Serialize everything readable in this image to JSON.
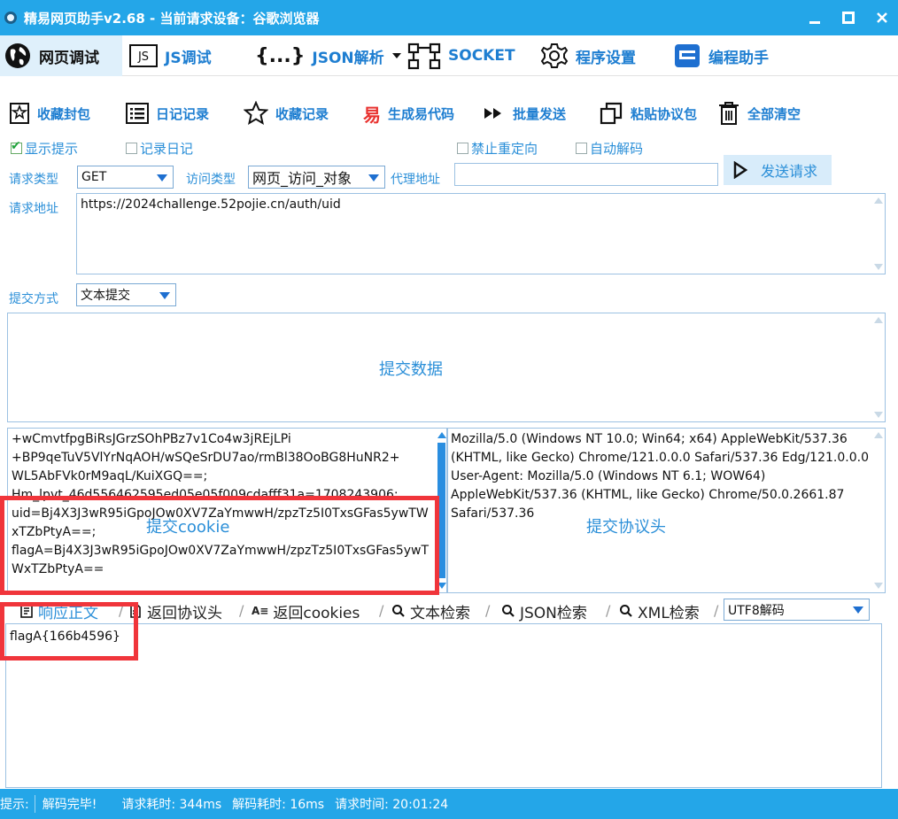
{
  "window": {
    "title": "精易网页助手v2.68  -  当前请求设备：谷歌浏览器"
  },
  "tabs": [
    {
      "label": "网页调试",
      "icon": "globe-icon"
    },
    {
      "label": "JS调试",
      "icon": "js-icon"
    },
    {
      "label": "JSON解析",
      "icon": "braces-icon"
    },
    {
      "label": "SOCKET",
      "icon": "socket-icon"
    },
    {
      "label": "程序设置",
      "icon": "gear-icon"
    },
    {
      "label": "编程助手",
      "icon": "assistant-icon"
    }
  ],
  "toolbar": [
    {
      "label": "收藏封包",
      "icon": "bookmark-icon"
    },
    {
      "label": "日记记录",
      "icon": "list-icon"
    },
    {
      "label": "收藏记录",
      "icon": "star-icon"
    },
    {
      "label": "生成易代码",
      "icon": "yi-icon",
      "icon_text": "易"
    },
    {
      "label": "批量发送",
      "icon": "fast-forward-icon"
    },
    {
      "label": "粘贴协议包",
      "icon": "copy-icon"
    },
    {
      "label": "全部清空",
      "icon": "trash-icon"
    }
  ],
  "options": {
    "show_tips": "显示提示",
    "log_diary": "记录日记",
    "no_redirect": "禁止重定向",
    "auto_decode": "自动解码"
  },
  "request": {
    "type_label": "请求类型",
    "type_value": "GET",
    "access_label": "访问类型",
    "access_value": "网页_访问_对象",
    "proxy_label": "代理地址",
    "proxy_value": "",
    "send_label": "发送请求",
    "url_label": "请求地址",
    "url_value": "https://2024challenge.52pojie.cn/auth/uid",
    "submit_mode_label": "提交方式",
    "submit_mode_value": "文本提交",
    "post_data_placeholder": "提交数据",
    "cookie_placeholder": "提交cookie",
    "cookie_value": "+wCmvtfpgBiRsJGrzSOhPBz7v1Co4w3jREjLPi\n+BP9qeTuV5VlYrNqAOH/wSQeSrDU7ao/rmBl38OoBG8HuNR2+\nWL5AbFVk0rM9aqL/KuiXGQ==;\nHm_lpvt_46d556462595ed05e05f009cdafff31a=1708243906;\nuid=Bj4X3J3wR95iGpoJOw0XV7ZaYmwwH/zpzTz5I0TxsGFas5ywTWxTZbPtyA==;\nflagA=Bj4X3J3wR95iGpoJOw0XV7ZaYmwwH/zpzTz5I0TxsGFas5ywTWxTZbPtyA==",
    "headers_placeholder": "提交协议头",
    "headers_value": "Mozilla/5.0 (Windows NT 10.0; Win64; x64) AppleWebKit/537.36 (KHTML, like Gecko) Chrome/121.0.0.0 Safari/537.36 Edg/121.0.0.0\nUser-Agent: Mozilla/5.0 (Windows NT 6.1; WOW64) AppleWebKit/537.36 (KHTML, like Gecko) Chrome/50.0.2661.87 Safari/537.36"
  },
  "response_tabs": [
    {
      "label": "响应正文",
      "icon": "document-icon"
    },
    {
      "label": "返回协议头",
      "icon": "file-icon"
    },
    {
      "label": "返回cookies",
      "icon": "cookie-icon"
    },
    {
      "label": "文本检索",
      "icon": "search-icon"
    },
    {
      "label": "JSON检索",
      "icon": "search-icon"
    },
    {
      "label": "XML检索",
      "icon": "search-icon"
    }
  ],
  "decode_value": "UTF8解码",
  "response_body": "flagA{166b4596}",
  "status": {
    "prefix": "提示:",
    "message": "解码完毕!",
    "request_time": "请求耗时: 344ms",
    "decode_time": "解码耗时: 16ms",
    "request_at": "请求时间: 20:01:24"
  },
  "colors": {
    "accent": "#24a6e8",
    "link_blue": "#1e7ed1",
    "highlight_red": "#f0353b"
  }
}
